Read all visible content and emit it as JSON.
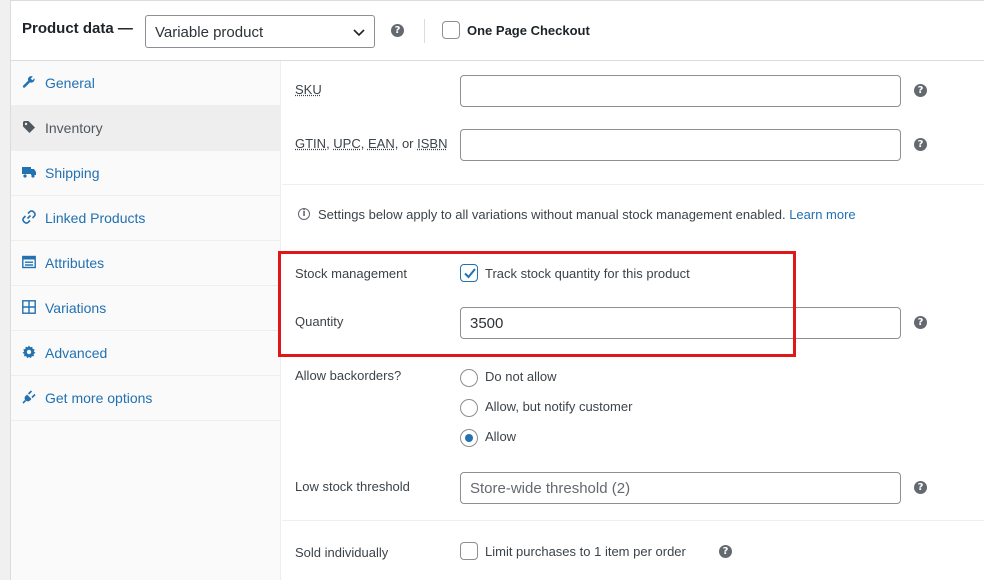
{
  "header": {
    "title": "Product data —",
    "product_type": "Variable product",
    "one_page_checkout_label": "One Page Checkout",
    "one_page_checkout_checked": false
  },
  "sidebar": {
    "items": [
      {
        "label": "General",
        "icon": "wrench-icon",
        "active": false
      },
      {
        "label": "Inventory",
        "icon": "tag-icon",
        "active": true
      },
      {
        "label": "Shipping",
        "icon": "truck-icon",
        "active": false
      },
      {
        "label": "Linked Products",
        "icon": "link-icon",
        "active": false
      },
      {
        "label": "Attributes",
        "icon": "list-icon",
        "active": false
      },
      {
        "label": "Variations",
        "icon": "grid-icon",
        "active": false
      },
      {
        "label": "Advanced",
        "icon": "gear-icon",
        "active": false
      },
      {
        "label": "Get more options",
        "icon": "plugin-icon",
        "active": false
      }
    ]
  },
  "inventory": {
    "sku_label": "SKU",
    "sku_value": "",
    "gtin_label_parts": [
      "GTIN",
      ", ",
      "UPC",
      ", ",
      "EAN",
      ", or ",
      "ISBN"
    ],
    "gtin_value": "",
    "info_text": "Settings below apply to all variations without manual stock management enabled.",
    "info_link": "Learn more",
    "stock_management_label": "Stock management",
    "track_stock_label": "Track stock quantity for this product",
    "track_stock_checked": true,
    "quantity_label": "Quantity",
    "quantity_value": "3500",
    "backorders_label": "Allow backorders?",
    "backorder_options": [
      {
        "label": "Do not allow",
        "checked": false
      },
      {
        "label": "Allow, but notify customer",
        "checked": false
      },
      {
        "label": "Allow",
        "checked": true
      }
    ],
    "low_stock_label": "Low stock threshold",
    "low_stock_placeholder": "Store-wide threshold (2)",
    "sold_individually_label": "Sold individually",
    "limit_purchases_label": "Limit purchases to 1 item per order",
    "limit_purchases_checked": false
  },
  "colors": {
    "accent": "#2271b1",
    "highlight": "#e0161b"
  }
}
